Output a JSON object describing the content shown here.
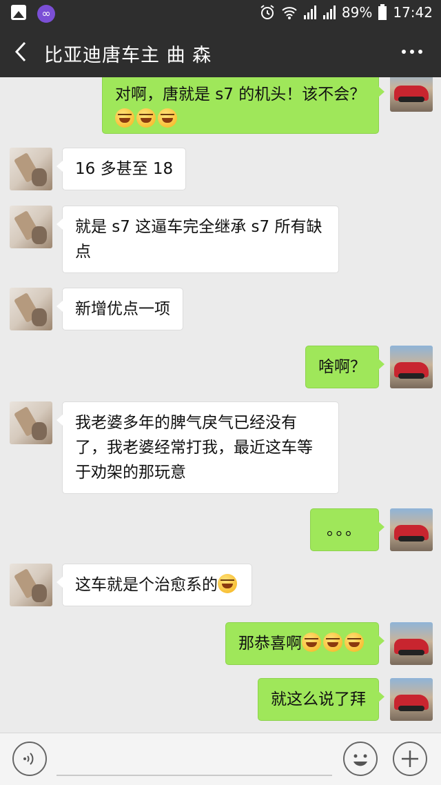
{
  "status_bar": {
    "battery_percent": "89%",
    "time": "17:42",
    "icons": [
      "gallery-icon",
      "infinity-app-icon",
      "alarm-icon",
      "wifi-icon",
      "signal-icon",
      "signal-icon",
      "battery-icon"
    ]
  },
  "header": {
    "title": "比亚迪唐车主 曲 森",
    "back_icon": "chevron-left-icon",
    "more_icon": "more-dots-icon"
  },
  "messages": [
    {
      "sender": "self",
      "text": "对啊，唐就是 s7 的机头！该不会？",
      "emoji_count": 3
    },
    {
      "sender": "other",
      "text": "16 多甚至 18"
    },
    {
      "sender": "other",
      "text": "就是 s7 这逼车完全继承 s7 所有缺\n点"
    },
    {
      "sender": "other",
      "text": "新增优点一项"
    },
    {
      "sender": "self",
      "text": "啥啊？"
    },
    {
      "sender": "other",
      "text": "我老婆多年的脾气戾气已经没有\n了，我老婆经常打我，最近这车等\n于劝架的那玩意"
    },
    {
      "sender": "self",
      "text": "。。。"
    },
    {
      "sender": "other",
      "text": "这车就是个治愈系的",
      "emoji_count": 1
    },
    {
      "sender": "self",
      "text": "那恭喜啊",
      "emoji_count": 3
    },
    {
      "sender": "self",
      "text": "就这么说了拜"
    }
  ],
  "input_bar": {
    "voice_icon": "voice-icon",
    "text_value": "",
    "emoji_icon": "smiley-icon",
    "plus_icon": "plus-icon"
  },
  "colors": {
    "header_bg": "#2e2e2e",
    "chat_bg": "#ebebeb",
    "self_bubble": "#9fe75a",
    "other_bubble": "#ffffff"
  }
}
